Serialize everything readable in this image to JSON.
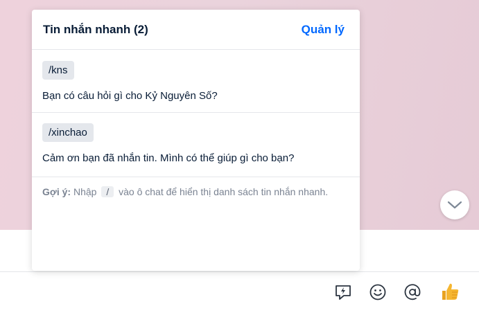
{
  "quick_messages": {
    "title": "Tin nhắn nhanh (2)",
    "manage_label": "Quản lý",
    "items": [
      {
        "shortcut": "/kns",
        "message": "Bạn có câu hỏi gì cho Kỷ Nguyên Số?"
      },
      {
        "shortcut": "/xinchao",
        "message": "Cảm ơn bạn đã nhắn tin. Mình có thể giúp gì cho bạn?"
      }
    ],
    "hint": {
      "label": "Gợi ý:",
      "before": "Nhập",
      "slash": "/",
      "after": "vào ô chat để hiển thị danh sách tin nhắn nhanh."
    }
  },
  "toolbar": {
    "icons": [
      "quick-message-icon",
      "emoji-icon",
      "mention-icon",
      "thumbs-up-icon"
    ]
  },
  "colors": {
    "accent": "#0068ff",
    "chat_background": "#ebd3dc",
    "thumbs_up": "#f5b631"
  }
}
